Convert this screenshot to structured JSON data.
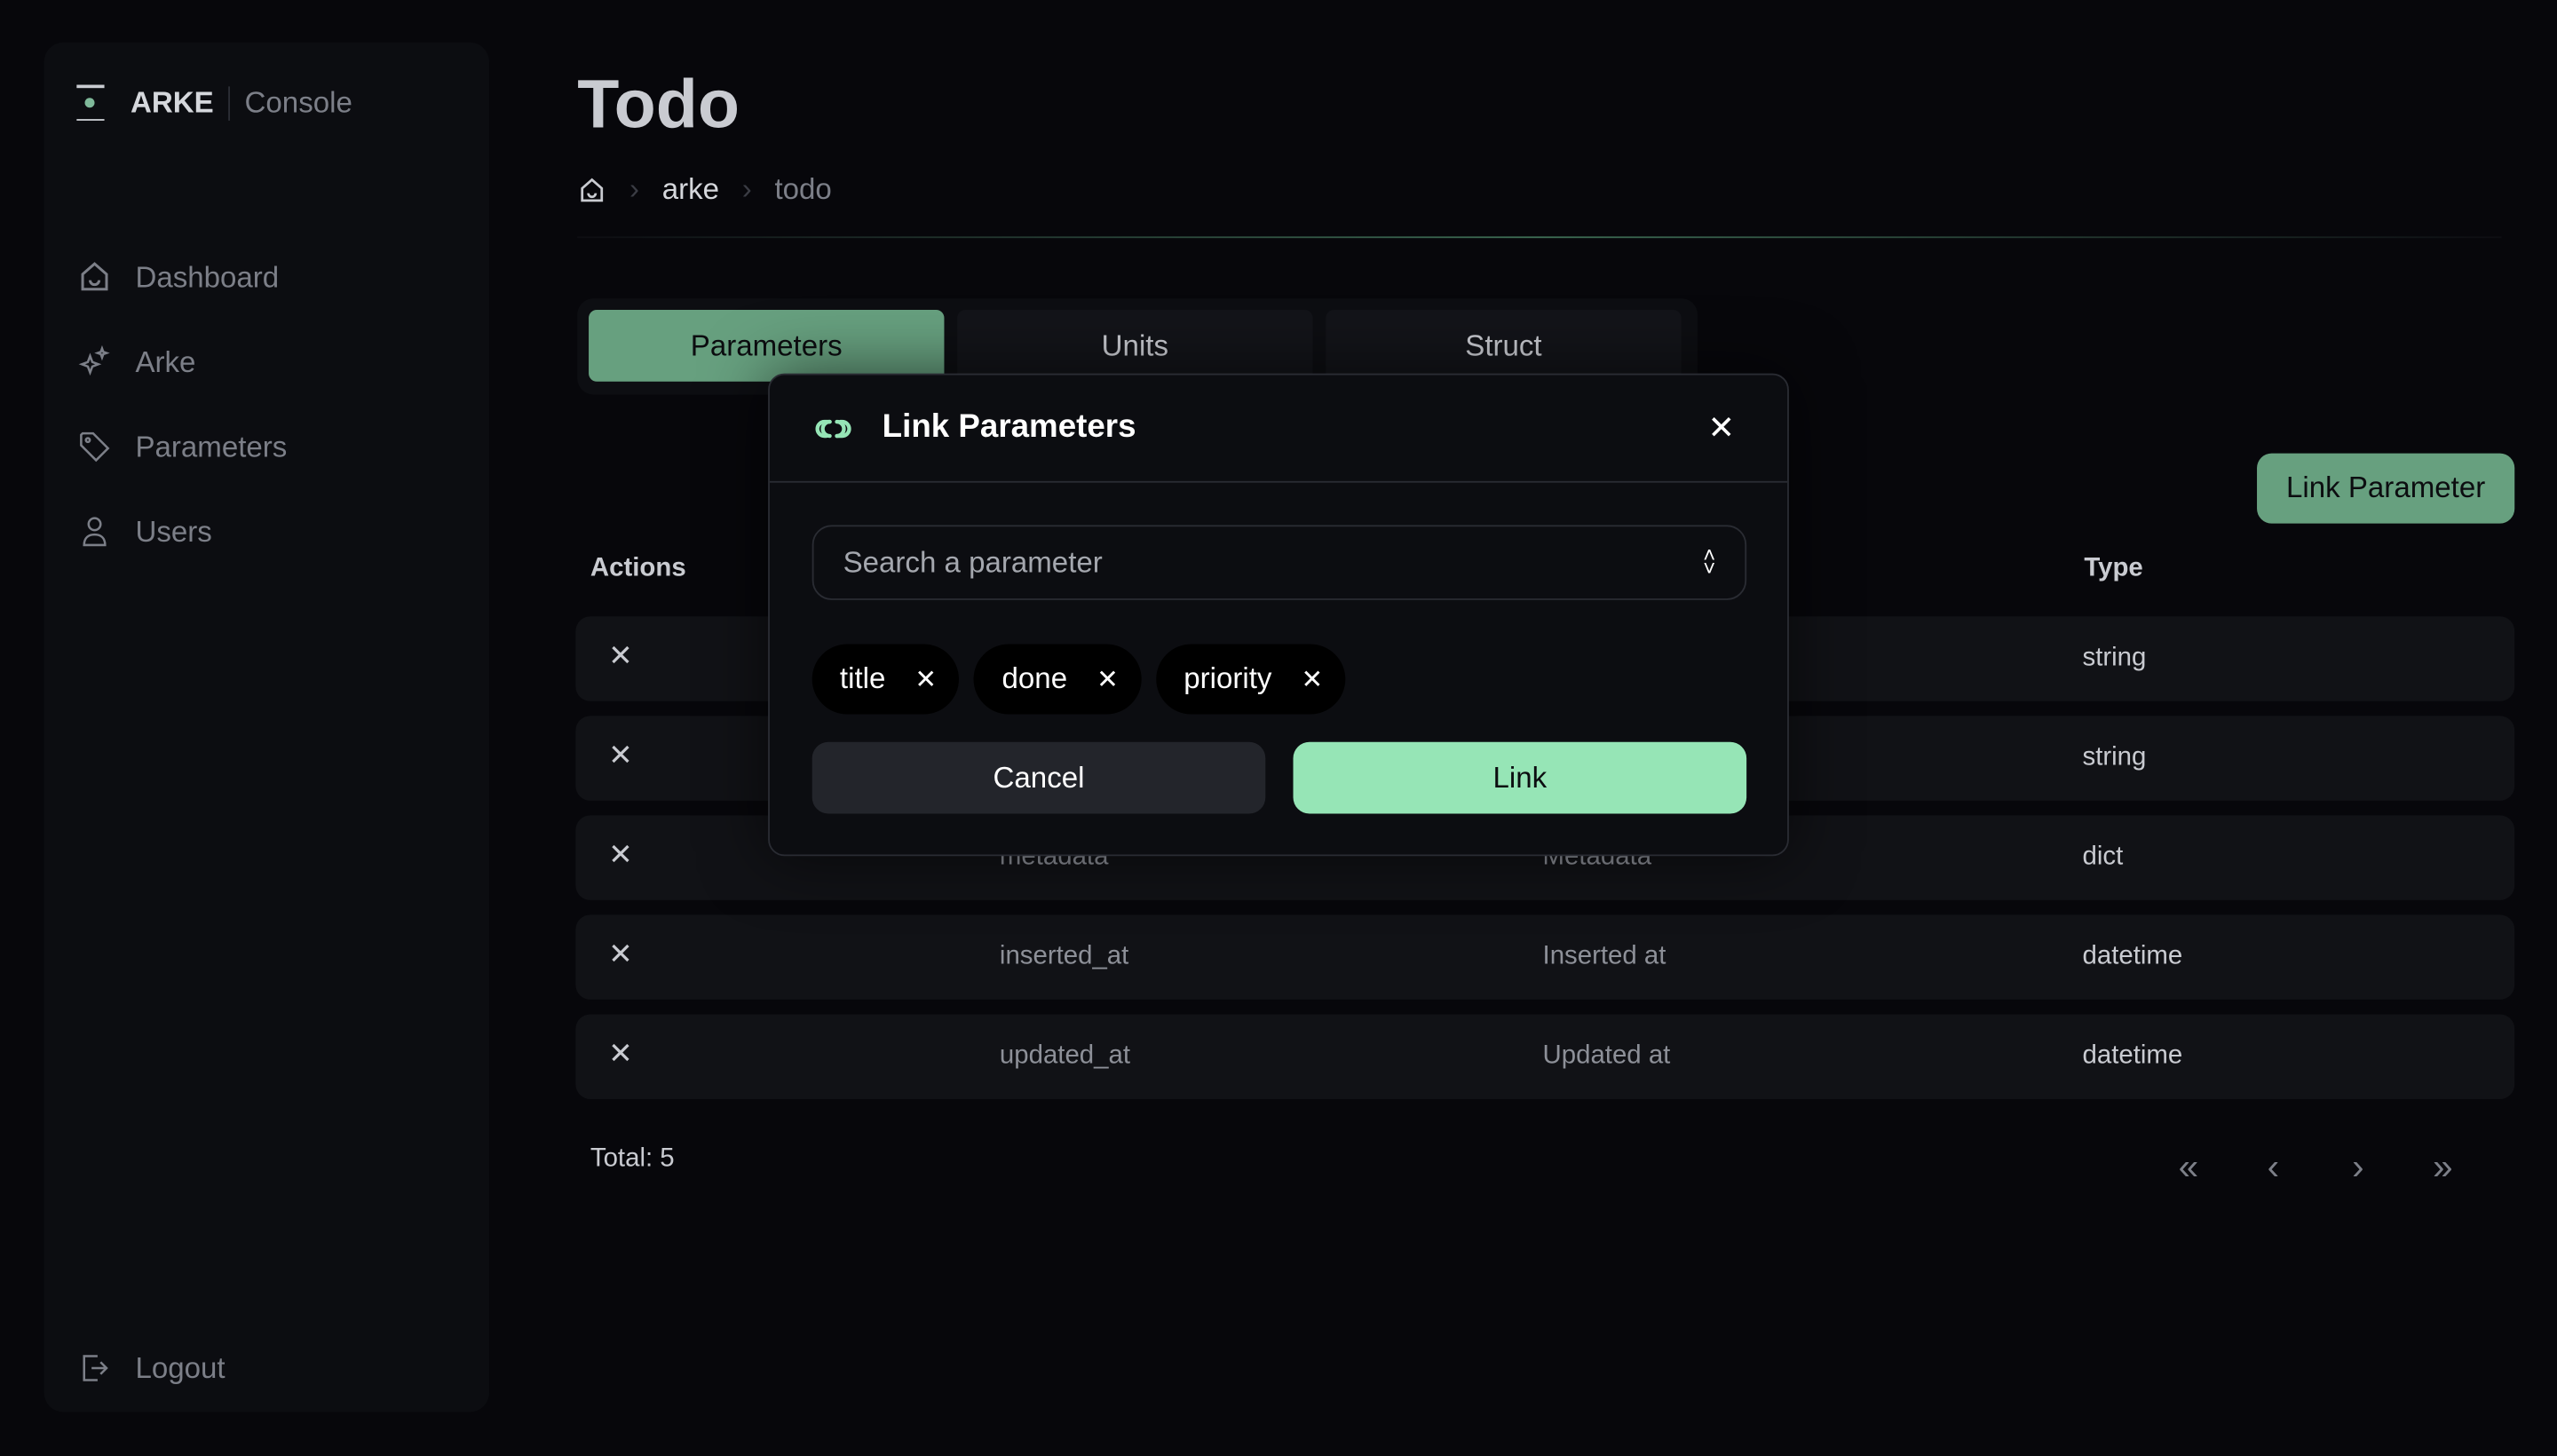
{
  "brand": {
    "name": "ARKE",
    "product": "Console"
  },
  "sidebar": {
    "items": [
      {
        "label": "Dashboard",
        "icon": "home-icon"
      },
      {
        "label": "Arke",
        "icon": "sparkles-icon"
      },
      {
        "label": "Parameters",
        "icon": "tag-icon"
      },
      {
        "label": "Users",
        "icon": "user-icon"
      }
    ],
    "logout": "Logout"
  },
  "page": {
    "title": "Todo",
    "breadcrumb": [
      "arke",
      "todo"
    ]
  },
  "tabs": [
    {
      "label": "Parameters",
      "active": true
    },
    {
      "label": "Units"
    },
    {
      "label": "Struct"
    }
  ],
  "link_parameter_button": "Link Parameter",
  "table": {
    "headers": {
      "actions": "Actions",
      "type": "Type"
    },
    "rows": [
      {
        "id": "",
        "label": "",
        "type": "string"
      },
      {
        "id": "",
        "label": "",
        "type": "string"
      },
      {
        "id": "metadata",
        "label": "Metadata",
        "type": "dict"
      },
      {
        "id": "inserted_at",
        "label": "Inserted at",
        "type": "datetime"
      },
      {
        "id": "updated_at",
        "label": "Updated at",
        "type": "datetime"
      }
    ]
  },
  "total": "Total: 5",
  "pager": {
    "first": "«",
    "prev": "‹",
    "next": "›",
    "last": "»"
  },
  "modal": {
    "title": "Link Parameters",
    "search_placeholder": "Search a parameter",
    "chips": [
      "title",
      "done",
      "priority"
    ],
    "cancel": "Cancel",
    "link": "Link"
  },
  "colors": {
    "accent": "#67a07f",
    "link_button": "#96e5b6",
    "background": "#07070b"
  }
}
